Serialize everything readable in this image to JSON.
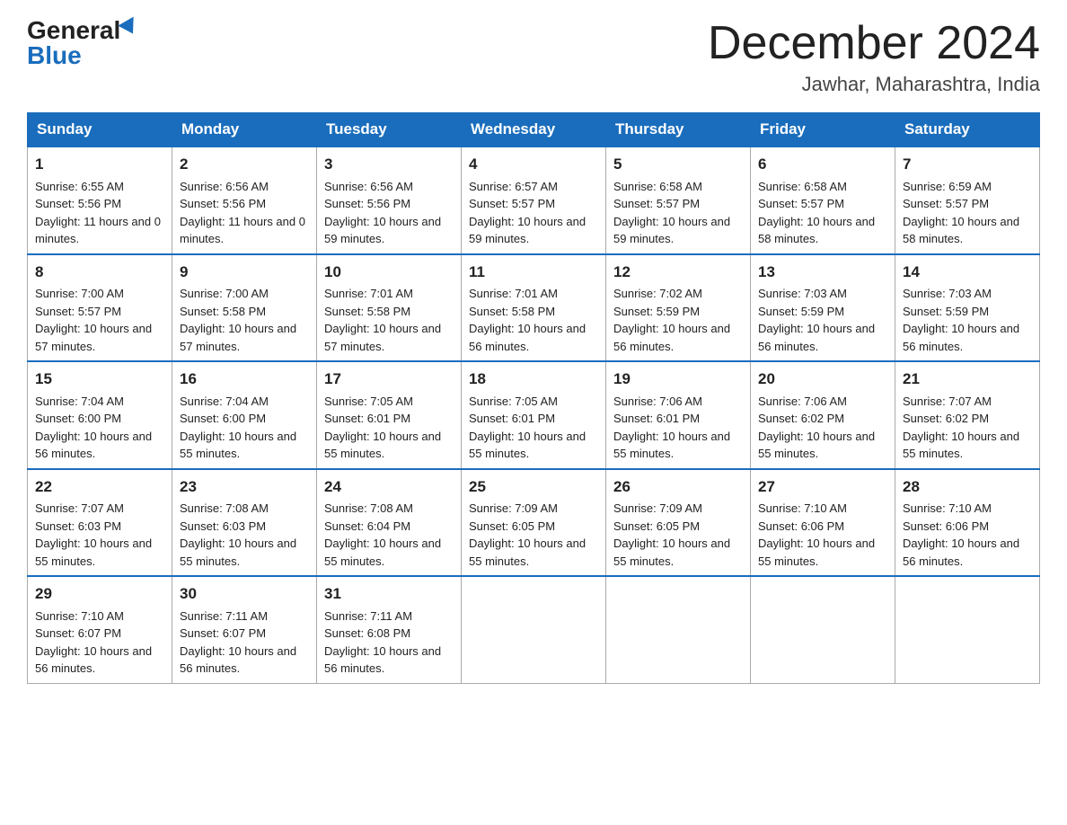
{
  "header": {
    "logo_general": "General",
    "logo_blue": "Blue",
    "month_title": "December 2024",
    "location": "Jawhar, Maharashtra, India"
  },
  "days_of_week": [
    "Sunday",
    "Monday",
    "Tuesday",
    "Wednesday",
    "Thursday",
    "Friday",
    "Saturday"
  ],
  "weeks": [
    [
      {
        "day": "1",
        "sunrise": "6:55 AM",
        "sunset": "5:56 PM",
        "daylight": "11 hours and 0 minutes."
      },
      {
        "day": "2",
        "sunrise": "6:56 AM",
        "sunset": "5:56 PM",
        "daylight": "11 hours and 0 minutes."
      },
      {
        "day": "3",
        "sunrise": "6:56 AM",
        "sunset": "5:56 PM",
        "daylight": "10 hours and 59 minutes."
      },
      {
        "day": "4",
        "sunrise": "6:57 AM",
        "sunset": "5:57 PM",
        "daylight": "10 hours and 59 minutes."
      },
      {
        "day": "5",
        "sunrise": "6:58 AM",
        "sunset": "5:57 PM",
        "daylight": "10 hours and 59 minutes."
      },
      {
        "day": "6",
        "sunrise": "6:58 AM",
        "sunset": "5:57 PM",
        "daylight": "10 hours and 58 minutes."
      },
      {
        "day": "7",
        "sunrise": "6:59 AM",
        "sunset": "5:57 PM",
        "daylight": "10 hours and 58 minutes."
      }
    ],
    [
      {
        "day": "8",
        "sunrise": "7:00 AM",
        "sunset": "5:57 PM",
        "daylight": "10 hours and 57 minutes."
      },
      {
        "day": "9",
        "sunrise": "7:00 AM",
        "sunset": "5:58 PM",
        "daylight": "10 hours and 57 minutes."
      },
      {
        "day": "10",
        "sunrise": "7:01 AM",
        "sunset": "5:58 PM",
        "daylight": "10 hours and 57 minutes."
      },
      {
        "day": "11",
        "sunrise": "7:01 AM",
        "sunset": "5:58 PM",
        "daylight": "10 hours and 56 minutes."
      },
      {
        "day": "12",
        "sunrise": "7:02 AM",
        "sunset": "5:59 PM",
        "daylight": "10 hours and 56 minutes."
      },
      {
        "day": "13",
        "sunrise": "7:03 AM",
        "sunset": "5:59 PM",
        "daylight": "10 hours and 56 minutes."
      },
      {
        "day": "14",
        "sunrise": "7:03 AM",
        "sunset": "5:59 PM",
        "daylight": "10 hours and 56 minutes."
      }
    ],
    [
      {
        "day": "15",
        "sunrise": "7:04 AM",
        "sunset": "6:00 PM",
        "daylight": "10 hours and 56 minutes."
      },
      {
        "day": "16",
        "sunrise": "7:04 AM",
        "sunset": "6:00 PM",
        "daylight": "10 hours and 55 minutes."
      },
      {
        "day": "17",
        "sunrise": "7:05 AM",
        "sunset": "6:01 PM",
        "daylight": "10 hours and 55 minutes."
      },
      {
        "day": "18",
        "sunrise": "7:05 AM",
        "sunset": "6:01 PM",
        "daylight": "10 hours and 55 minutes."
      },
      {
        "day": "19",
        "sunrise": "7:06 AM",
        "sunset": "6:01 PM",
        "daylight": "10 hours and 55 minutes."
      },
      {
        "day": "20",
        "sunrise": "7:06 AM",
        "sunset": "6:02 PM",
        "daylight": "10 hours and 55 minutes."
      },
      {
        "day": "21",
        "sunrise": "7:07 AM",
        "sunset": "6:02 PM",
        "daylight": "10 hours and 55 minutes."
      }
    ],
    [
      {
        "day": "22",
        "sunrise": "7:07 AM",
        "sunset": "6:03 PM",
        "daylight": "10 hours and 55 minutes."
      },
      {
        "day": "23",
        "sunrise": "7:08 AM",
        "sunset": "6:03 PM",
        "daylight": "10 hours and 55 minutes."
      },
      {
        "day": "24",
        "sunrise": "7:08 AM",
        "sunset": "6:04 PM",
        "daylight": "10 hours and 55 minutes."
      },
      {
        "day": "25",
        "sunrise": "7:09 AM",
        "sunset": "6:05 PM",
        "daylight": "10 hours and 55 minutes."
      },
      {
        "day": "26",
        "sunrise": "7:09 AM",
        "sunset": "6:05 PM",
        "daylight": "10 hours and 55 minutes."
      },
      {
        "day": "27",
        "sunrise": "7:10 AM",
        "sunset": "6:06 PM",
        "daylight": "10 hours and 55 minutes."
      },
      {
        "day": "28",
        "sunrise": "7:10 AM",
        "sunset": "6:06 PM",
        "daylight": "10 hours and 56 minutes."
      }
    ],
    [
      {
        "day": "29",
        "sunrise": "7:10 AM",
        "sunset": "6:07 PM",
        "daylight": "10 hours and 56 minutes."
      },
      {
        "day": "30",
        "sunrise": "7:11 AM",
        "sunset": "6:07 PM",
        "daylight": "10 hours and 56 minutes."
      },
      {
        "day": "31",
        "sunrise": "7:11 AM",
        "sunset": "6:08 PM",
        "daylight": "10 hours and 56 minutes."
      },
      null,
      null,
      null,
      null
    ]
  ]
}
